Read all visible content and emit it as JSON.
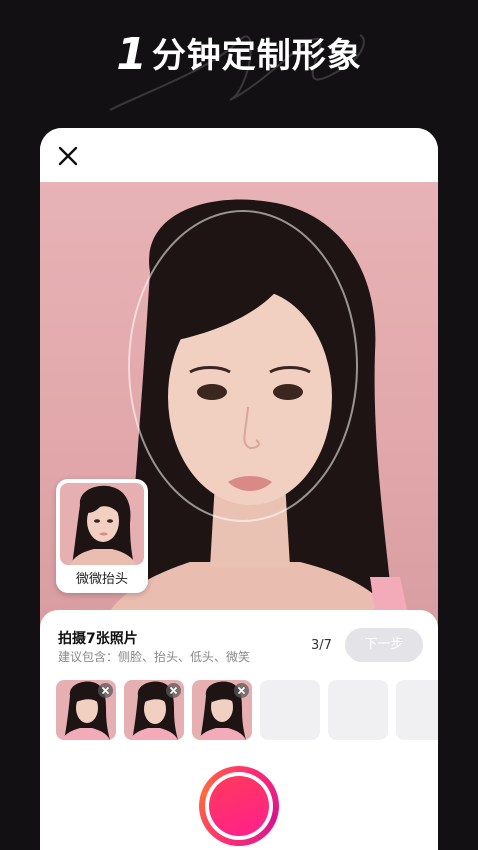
{
  "headline": {
    "number": "1",
    "text": "分钟定制形象"
  },
  "icons": {
    "close": "close-icon",
    "remove": "remove-x-icon"
  },
  "reference": {
    "label": "微微抬头"
  },
  "panel": {
    "title": "拍摄7张照片",
    "subtitle": "建议包含：侧脸、抬头、低头、微笑",
    "counter": "3/7",
    "next_label": "下一步"
  },
  "thumbnails": [
    {
      "filled": true
    },
    {
      "filled": true
    },
    {
      "filled": true
    },
    {
      "filled": false
    },
    {
      "filled": false
    },
    {
      "filled": false
    }
  ],
  "colors": {
    "background": "#121012",
    "photo_bg": "#e7b3b6",
    "accent_start": "#ff3a5a",
    "accent_end": "#ff1f8f",
    "next_disabled": "#e4e4e8"
  }
}
